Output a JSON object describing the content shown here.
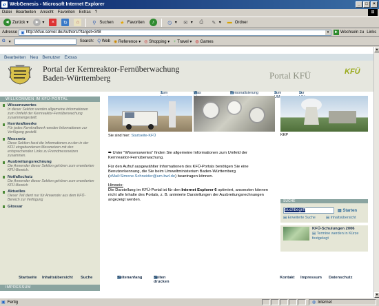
{
  "window": {
    "title": "WebGenesis - Microsoft Internet Explorer"
  },
  "menu": [
    "Datei",
    "Bearbeiten",
    "Ansicht",
    "Favoriten",
    "Extras",
    "?"
  ],
  "toolbar": {
    "back": "Zurück",
    "search": "Suchen",
    "favorites": "Favoriten",
    "folder": "Ordner"
  },
  "address": {
    "label": "Adresse",
    "url": "http://kfue.server.de/Authors/?target=348",
    "go": "Wechseln zu",
    "links": "Links"
  },
  "google": {
    "search_label": "Search:",
    "web": "Web",
    "reference": "Reference",
    "shopping": "Shopping",
    "travel": "Travel",
    "games": "Games"
  },
  "cms": [
    "Bearbeiten",
    "Neu",
    "Benutzer",
    "Extras"
  ],
  "header": {
    "title_line1": "Portal der Kernreaktor-Fernüberwachung",
    "title_line2": "Baden-Württemberg",
    "portal": "Portal KFÜ",
    "logo": "KFÜ"
  },
  "topnav": [
    "zum Login",
    "Was ist neu?",
    "Personalisierung",
    "zum UM",
    "zur LfU"
  ],
  "sidebar": {
    "head": "WILLKOMMEN IM KFÜ-PORTAL",
    "items": [
      {
        "title": "Wissenswertes",
        "desc": "In dieser Sektion werden allgemeine Informationen zum Umfeld der Kernreaktor-Fernüberwachung zusammengestellt."
      },
      {
        "title": "Kernkraftwerke",
        "desc": "Für jedes Kernkraftwerk werden Informationen zur Verfügung gestellt."
      },
      {
        "title": "Messnetz",
        "desc": "Diese Sektion fasst die Informationen zu den in der KFÜ eingebundenen Messnetzen mit den entsprechenden Links zu Fremdmessnetzen zusammen."
      },
      {
        "title": "Ausbreitungsrechnung",
        "desc": "Die Anwender dieser Sektion gehören zum erweiterten KFÜ-Bereich."
      },
      {
        "title": "Notfallschutz",
        "desc": "Die Anwender dieser Sektion gehören zum erweiterten KFÜ-Bereich"
      },
      {
        "title": "Aktuelles",
        "desc": "Dieser Teil dient nur für Anwender aus dem KFÜ-Bereich zur Verfügung"
      },
      {
        "title": "Glossar",
        "desc": ""
      }
    ],
    "impressum": "IMPRESSUM"
  },
  "location": {
    "prefix": "Sie sind hier:",
    "link": "Startseite-KFÜ"
  },
  "main": {
    "p1": "Unter \"Wissenswertes\" finden Sie allgemeine Informationen zum Umfeld der Kernreaktor-Fernüberwachung.",
    "p2a": "Für den Aufruf ausgewählter Informationen des KFÜ-Portals benötigen Sie eine Benutzerkennung, die Sie beim Umweltministerium Baden-Württemberg (",
    "p2link": "eMail:Simone.Schneider@um.bwl.de",
    "p2b": ") beantragen können.",
    "hinweis": "Hinweis:",
    "p3a": "Die Darstellung im KFÜ-Portal ist für den ",
    "p3b": "Internet Explorer 6",
    "p3c": " optimiert, ansonsten können nicht alle Inhalte des Portals, z. B. animierte Darstellungen der Ausbreitungsrechnungen angezeigt werden."
  },
  "right": {
    "kkp": "KKP",
    "suche_head": "SUCHE",
    "suche_value": "Suchbegriff",
    "starten": "Starten",
    "erweitert": "Erweiterte Suche",
    "inhalt": "Inhaltsübersicht",
    "schul_title": "KFÜ-Schulungen 2006",
    "schul_text": "Termine werden in Kürze festgelegt"
  },
  "footer": {
    "start": "Startseite",
    "inhalt": "Inhaltsübersicht",
    "suche": "Suche",
    "anfang": "Seitenanfang",
    "drucken": "Seiten drucken",
    "kontakt": "Kontakt",
    "impressum": "Impressum",
    "datenschutz": "Datenschutz"
  },
  "status": {
    "text": "Fertig",
    "zone": "Internet"
  }
}
